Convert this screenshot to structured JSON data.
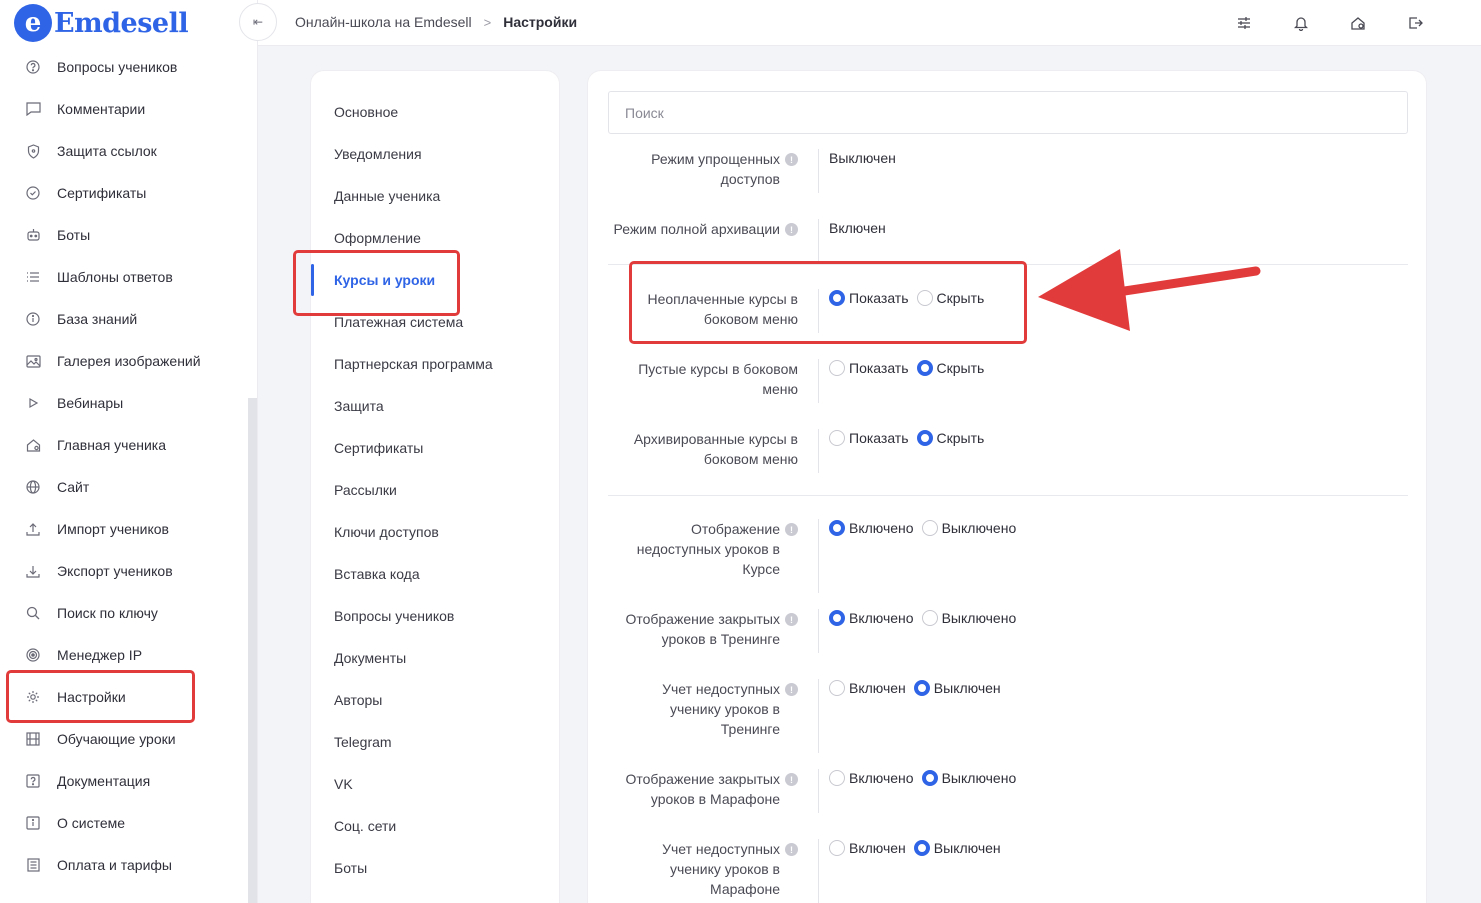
{
  "logo": {
    "letter": "e",
    "text": "Emdesell"
  },
  "header": {
    "breadcrumb": [
      "Онлайн-школа на Emdesell",
      "Настройки"
    ],
    "collapse_glyph": "⇤"
  },
  "sidebar": {
    "items": [
      {
        "label": "Вопросы учеников",
        "icon": "question-circle-icon"
      },
      {
        "label": "Комментарии",
        "icon": "comment-icon"
      },
      {
        "label": "Защита ссылок",
        "icon": "shield-icon"
      },
      {
        "label": "Сертификаты",
        "icon": "certificate-icon"
      },
      {
        "label": "Боты",
        "icon": "bot-icon"
      },
      {
        "label": "Шаблоны ответов",
        "icon": "list-icon"
      },
      {
        "label": "База знаний",
        "icon": "info-circle-icon"
      },
      {
        "label": "Галерея изображений",
        "icon": "image-icon"
      },
      {
        "label": "Вебинары",
        "icon": "play-icon"
      },
      {
        "label": "Главная ученика",
        "icon": "home-icon"
      },
      {
        "label": "Сайт",
        "icon": "globe-icon"
      },
      {
        "label": "Импорт учеников",
        "icon": "upload-icon"
      },
      {
        "label": "Экспорт учеников",
        "icon": "download-icon"
      },
      {
        "label": "Поиск по ключу",
        "icon": "search-icon"
      },
      {
        "label": "Менеджер IP",
        "icon": "target-icon"
      },
      {
        "label": "Настройки",
        "icon": "gear-icon",
        "active": true
      },
      {
        "label": "Обучающие уроки",
        "icon": "film-icon"
      },
      {
        "label": "Документация",
        "icon": "help-square-icon"
      },
      {
        "label": "О системе",
        "icon": "info-square-icon"
      },
      {
        "label": "Оплата и тарифы",
        "icon": "receipt-icon"
      }
    ]
  },
  "settings_menu": {
    "items": [
      {
        "label": "Основное"
      },
      {
        "label": "Уведомления"
      },
      {
        "label": "Данные ученика"
      },
      {
        "label": "Оформление"
      },
      {
        "label": "Курсы и уроки",
        "active": true
      },
      {
        "label": "Платежная система"
      },
      {
        "label": "Партнерская программа"
      },
      {
        "label": "Защита"
      },
      {
        "label": "Сертификаты"
      },
      {
        "label": "Рассылки"
      },
      {
        "label": "Ключи доступов"
      },
      {
        "label": "Вставка кода"
      },
      {
        "label": "Вопросы учеников"
      },
      {
        "label": "Документы"
      },
      {
        "label": "Авторы"
      },
      {
        "label": "Telegram"
      },
      {
        "label": "VK"
      },
      {
        "label": "Соц. сети"
      },
      {
        "label": "Боты"
      }
    ]
  },
  "content": {
    "search_placeholder": "Поиск",
    "settings": [
      {
        "label": "Режим упрощенных доступов",
        "info": true,
        "value_text": "Выключен"
      },
      {
        "label": "Режим полной архивации",
        "info": true,
        "value_text": "Включен"
      },
      {
        "label": "Неоплаченные курсы в боковом меню",
        "info": false,
        "options": [
          "Показать",
          "Скрыть"
        ],
        "selected": 0
      },
      {
        "label": "Пустые курсы в боковом меню",
        "info": false,
        "options": [
          "Показать",
          "Скрыть"
        ],
        "selected": 1
      },
      {
        "label": "Архивированные курсы в боковом меню",
        "info": false,
        "options": [
          "Показать",
          "Скрыть"
        ],
        "selected": 1
      },
      {
        "label": "Отображение недоступных уроков в Курсе",
        "info": true,
        "options": [
          "Включено",
          "Выключено"
        ],
        "selected": 0
      },
      {
        "label": "Отображение закрытых уроков в Тренинге",
        "info": true,
        "options": [
          "Включено",
          "Выключено"
        ],
        "selected": 0
      },
      {
        "label": "Учет недоступных ученику уроков в Тренинге",
        "info": true,
        "options": [
          "Включен",
          "Выключен"
        ],
        "selected": 1
      },
      {
        "label": "Отображение закрытых уроков в Марафоне",
        "info": true,
        "options": [
          "Включено",
          "Выключено"
        ],
        "selected": 1
      },
      {
        "label": "Учет недоступных ученику уроков в Марафоне",
        "info": true,
        "options": [
          "Включен",
          "Выключен"
        ],
        "selected": 1
      }
    ]
  },
  "colors": {
    "accent": "#2f64e6",
    "annotation": "#e23b3b"
  }
}
